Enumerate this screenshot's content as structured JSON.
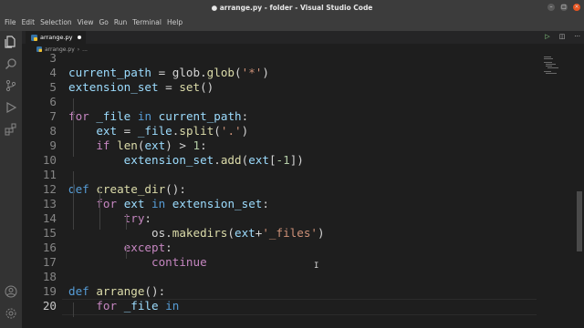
{
  "window": {
    "title": "● arrange.py - folder - Visual Studio Code"
  },
  "menu": [
    "File",
    "Edit",
    "Selection",
    "View",
    "Go",
    "Run",
    "Terminal",
    "Help"
  ],
  "tab": {
    "label": "arrange.py"
  },
  "breadcrumb": {
    "file": "arrange.py",
    "rest": "..."
  },
  "lines": [
    {
      "num": "3",
      "tokens": []
    },
    {
      "num": "4",
      "tokens": [
        [
          "var",
          "current_path"
        ],
        [
          "p",
          " = glob."
        ],
        [
          "fn",
          "glob"
        ],
        [
          "p",
          "("
        ],
        [
          "str",
          "'*'"
        ],
        [
          "p",
          ")"
        ]
      ]
    },
    {
      "num": "5",
      "tokens": [
        [
          "var",
          "extension_set"
        ],
        [
          "p",
          " = "
        ],
        [
          "fn",
          "set"
        ],
        [
          "p",
          "()"
        ]
      ]
    },
    {
      "num": "6",
      "tokens": []
    },
    {
      "num": "7",
      "tokens": [
        [
          "kwc",
          "for"
        ],
        [
          "p",
          " "
        ],
        [
          "var",
          "_file"
        ],
        [
          "p",
          " "
        ],
        [
          "kw",
          "in"
        ],
        [
          "p",
          " "
        ],
        [
          "var",
          "current_path"
        ],
        [
          "p",
          ":"
        ]
      ]
    },
    {
      "num": "8",
      "tokens": [
        [
          "p",
          "    "
        ],
        [
          "var",
          "ext"
        ],
        [
          "p",
          " = "
        ],
        [
          "var",
          "_file"
        ],
        [
          "p",
          "."
        ],
        [
          "fn",
          "split"
        ],
        [
          "p",
          "("
        ],
        [
          "str",
          "'.'"
        ],
        [
          "p",
          ")"
        ]
      ]
    },
    {
      "num": "9",
      "tokens": [
        [
          "p",
          "    "
        ],
        [
          "kwc",
          "if"
        ],
        [
          "p",
          " "
        ],
        [
          "fn",
          "len"
        ],
        [
          "p",
          "("
        ],
        [
          "var",
          "ext"
        ],
        [
          "p",
          ") > "
        ],
        [
          "num",
          "1"
        ],
        [
          "p",
          ":"
        ]
      ]
    },
    {
      "num": "10",
      "tokens": [
        [
          "p",
          "        "
        ],
        [
          "var",
          "extension_set"
        ],
        [
          "p",
          "."
        ],
        [
          "fn",
          "add"
        ],
        [
          "p",
          "("
        ],
        [
          "var",
          "ext"
        ],
        [
          "p",
          "["
        ],
        [
          "num",
          "-1"
        ],
        [
          "p",
          "])"
        ]
      ]
    },
    {
      "num": "11",
      "tokens": []
    },
    {
      "num": "12",
      "tokens": [
        [
          "kw",
          "def"
        ],
        [
          "p",
          " "
        ],
        [
          "fn",
          "create_dir"
        ],
        [
          "p",
          "():"
        ]
      ]
    },
    {
      "num": "13",
      "tokens": [
        [
          "p",
          "    "
        ],
        [
          "kwc",
          "for"
        ],
        [
          "p",
          " "
        ],
        [
          "var",
          "ext"
        ],
        [
          "p",
          " "
        ],
        [
          "kw",
          "in"
        ],
        [
          "p",
          " "
        ],
        [
          "var",
          "extension_set"
        ],
        [
          "p",
          ":"
        ]
      ]
    },
    {
      "num": "14",
      "tokens": [
        [
          "p",
          "        "
        ],
        [
          "kwc",
          "try"
        ],
        [
          "p",
          ":"
        ]
      ]
    },
    {
      "num": "15",
      "tokens": [
        [
          "p",
          "            os."
        ],
        [
          "fn",
          "makedirs"
        ],
        [
          "p",
          "("
        ],
        [
          "var",
          "ext"
        ],
        [
          "p",
          "+"
        ],
        [
          "str",
          "'_files'"
        ],
        [
          "p",
          ")"
        ]
      ]
    },
    {
      "num": "16",
      "tokens": [
        [
          "p",
          "        "
        ],
        [
          "kwc",
          "except"
        ],
        [
          "p",
          ":"
        ]
      ]
    },
    {
      "num": "17",
      "tokens": [
        [
          "p",
          "            "
        ],
        [
          "kwc",
          "continue"
        ]
      ]
    },
    {
      "num": "18",
      "tokens": []
    },
    {
      "num": "19",
      "tokens": [
        [
          "kw",
          "def"
        ],
        [
          "p",
          " "
        ],
        [
          "fn",
          "arrange"
        ],
        [
          "p",
          "():"
        ]
      ]
    },
    {
      "num": "20",
      "tokens": [
        [
          "p",
          "    "
        ],
        [
          "kwc",
          "for"
        ],
        [
          "p",
          " "
        ],
        [
          "var",
          "_file"
        ],
        [
          "p",
          " "
        ],
        [
          "kw",
          "in"
        ]
      ]
    }
  ],
  "current_line": "20",
  "colors": {
    "accent": "#007acc",
    "close": "#e95420"
  },
  "icons": [
    "explorer-icon",
    "search-icon",
    "source-control-icon",
    "run-debug-icon",
    "extensions-icon",
    "account-icon",
    "settings-gear-icon",
    "run-icon",
    "split-editor-icon",
    "more-icon"
  ]
}
